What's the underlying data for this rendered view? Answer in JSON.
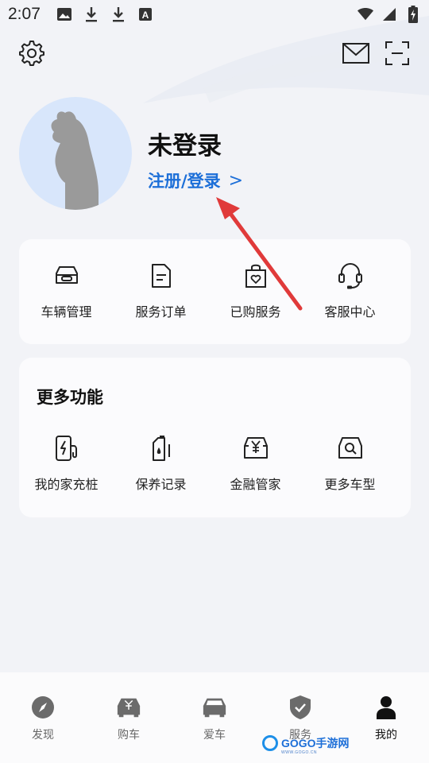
{
  "status_bar": {
    "time": "2:07",
    "left_icons": [
      "image-icon",
      "download-icon",
      "download-icon",
      "font-icon"
    ],
    "right_icons": [
      "wifi-icon",
      "signal-icon",
      "battery-icon"
    ]
  },
  "header": {
    "settings_icon": "gear-icon",
    "message_icon": "mail-icon",
    "scan_icon": "scan-icon"
  },
  "profile": {
    "title": "未登录",
    "login_link": "注册/登录",
    "login_chevron": ">"
  },
  "services": {
    "items": [
      {
        "label": "车辆管理",
        "icon": "car-manage-icon"
      },
      {
        "label": "服务订单",
        "icon": "order-document-icon"
      },
      {
        "label": "已购服务",
        "icon": "purchased-bag-icon"
      },
      {
        "label": "客服中心",
        "icon": "headset-icon"
      }
    ]
  },
  "more": {
    "title": "更多功能",
    "items": [
      {
        "label": "我的家充桩",
        "icon": "charger-icon"
      },
      {
        "label": "保养记录",
        "icon": "oil-can-icon"
      },
      {
        "label": "金融管家",
        "icon": "finance-car-icon"
      },
      {
        "label": "更多车型",
        "icon": "car-search-icon"
      }
    ]
  },
  "bottom_nav": {
    "items": [
      {
        "label": "发现",
        "icon": "compass-icon"
      },
      {
        "label": "购车",
        "icon": "buy-car-icon"
      },
      {
        "label": "爱车",
        "icon": "car-icon"
      },
      {
        "label": "服务",
        "icon": "shield-check-icon"
      },
      {
        "label": "我的",
        "icon": "person-icon",
        "active": true
      }
    ]
  },
  "watermark": {
    "text": "GOGO手游网",
    "subtext": "WWW.GOGO.CN"
  },
  "colors": {
    "accent": "#1d6fd8",
    "annotation_arrow": "#e03a3a",
    "background": "#f2f3f7"
  }
}
